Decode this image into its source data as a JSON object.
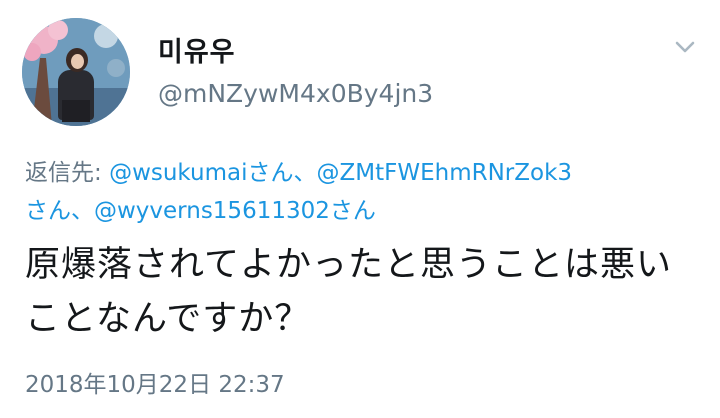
{
  "user": {
    "display_name": "미유우",
    "handle": "@mNZywM4x0By4jn3"
  },
  "menu": {
    "chevron_icon": "chevron-down-icon"
  },
  "reply": {
    "prefix": "返信先: ",
    "mention_1": "@wsukumai",
    "suffix_1": "さん、",
    "mention_2": "@ZMtFWEhmRNrZok3",
    "suffix_2": "さん、",
    "mention_3": "@wyverns15611302",
    "suffix_3": "さん"
  },
  "tweet": {
    "text": "原爆落されてよかったと思うことは悪いことなんですか？",
    "timestamp": "2018年10月22日 22:37"
  },
  "colors": {
    "text": "#14171a",
    "secondary": "#657786",
    "link": "#1b95e0"
  }
}
